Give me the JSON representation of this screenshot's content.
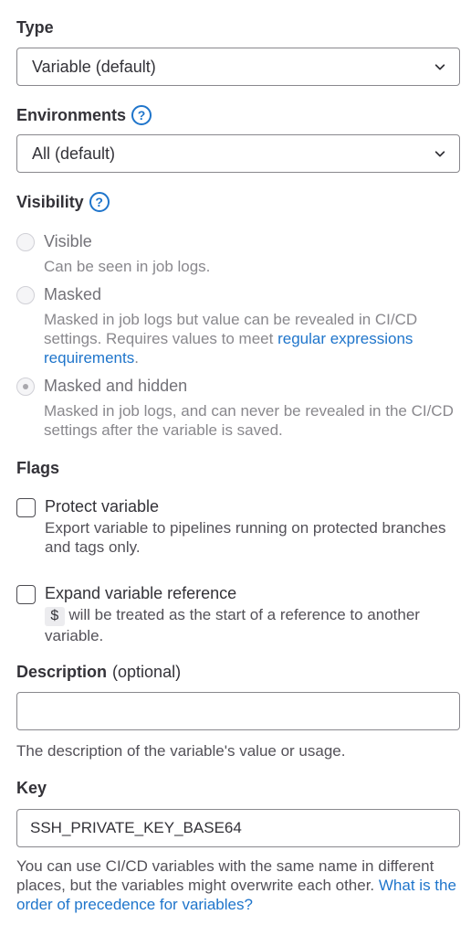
{
  "type": {
    "label": "Type",
    "selected": "Variable (default)"
  },
  "environments": {
    "label": "Environments",
    "selected": "All (default)"
  },
  "visibility": {
    "label": "Visibility",
    "options": [
      {
        "title": "Visible",
        "desc": "Can be seen in job logs."
      },
      {
        "title": "Masked",
        "desc": "Masked in job logs but value can be revealed in CI/CD settings. Requires values to meet ",
        "link": "regular expressions requirements",
        "desc_end": "."
      },
      {
        "title": "Masked and hidden",
        "desc": "Masked in job logs, and can never be revealed in the CI/CD settings after the variable is saved."
      }
    ]
  },
  "flags": {
    "label": "Flags",
    "protect": {
      "title": "Protect variable",
      "desc": "Export variable to pipelines running on protected branches and tags only."
    },
    "expand": {
      "title": "Expand variable reference",
      "code": "$",
      "desc": " will be treated as the start of a reference to another variable."
    }
  },
  "description": {
    "label": "Description",
    "optional": "(optional)",
    "value": "",
    "helper": "The description of the variable's value or usage."
  },
  "key": {
    "label": "Key",
    "value": "SSH_PRIVATE_KEY_BASE64",
    "helper": "You can use CI/CD variables with the same name in different places, but the variables might overwrite each other. ",
    "link": "What is the order of precedence for variables?"
  },
  "icons": {
    "help": "question-circle-icon",
    "chevron": "chevron-down-icon"
  },
  "colors": {
    "link": "#1f75cb",
    "text": "#333238",
    "muted": "#89888d"
  }
}
